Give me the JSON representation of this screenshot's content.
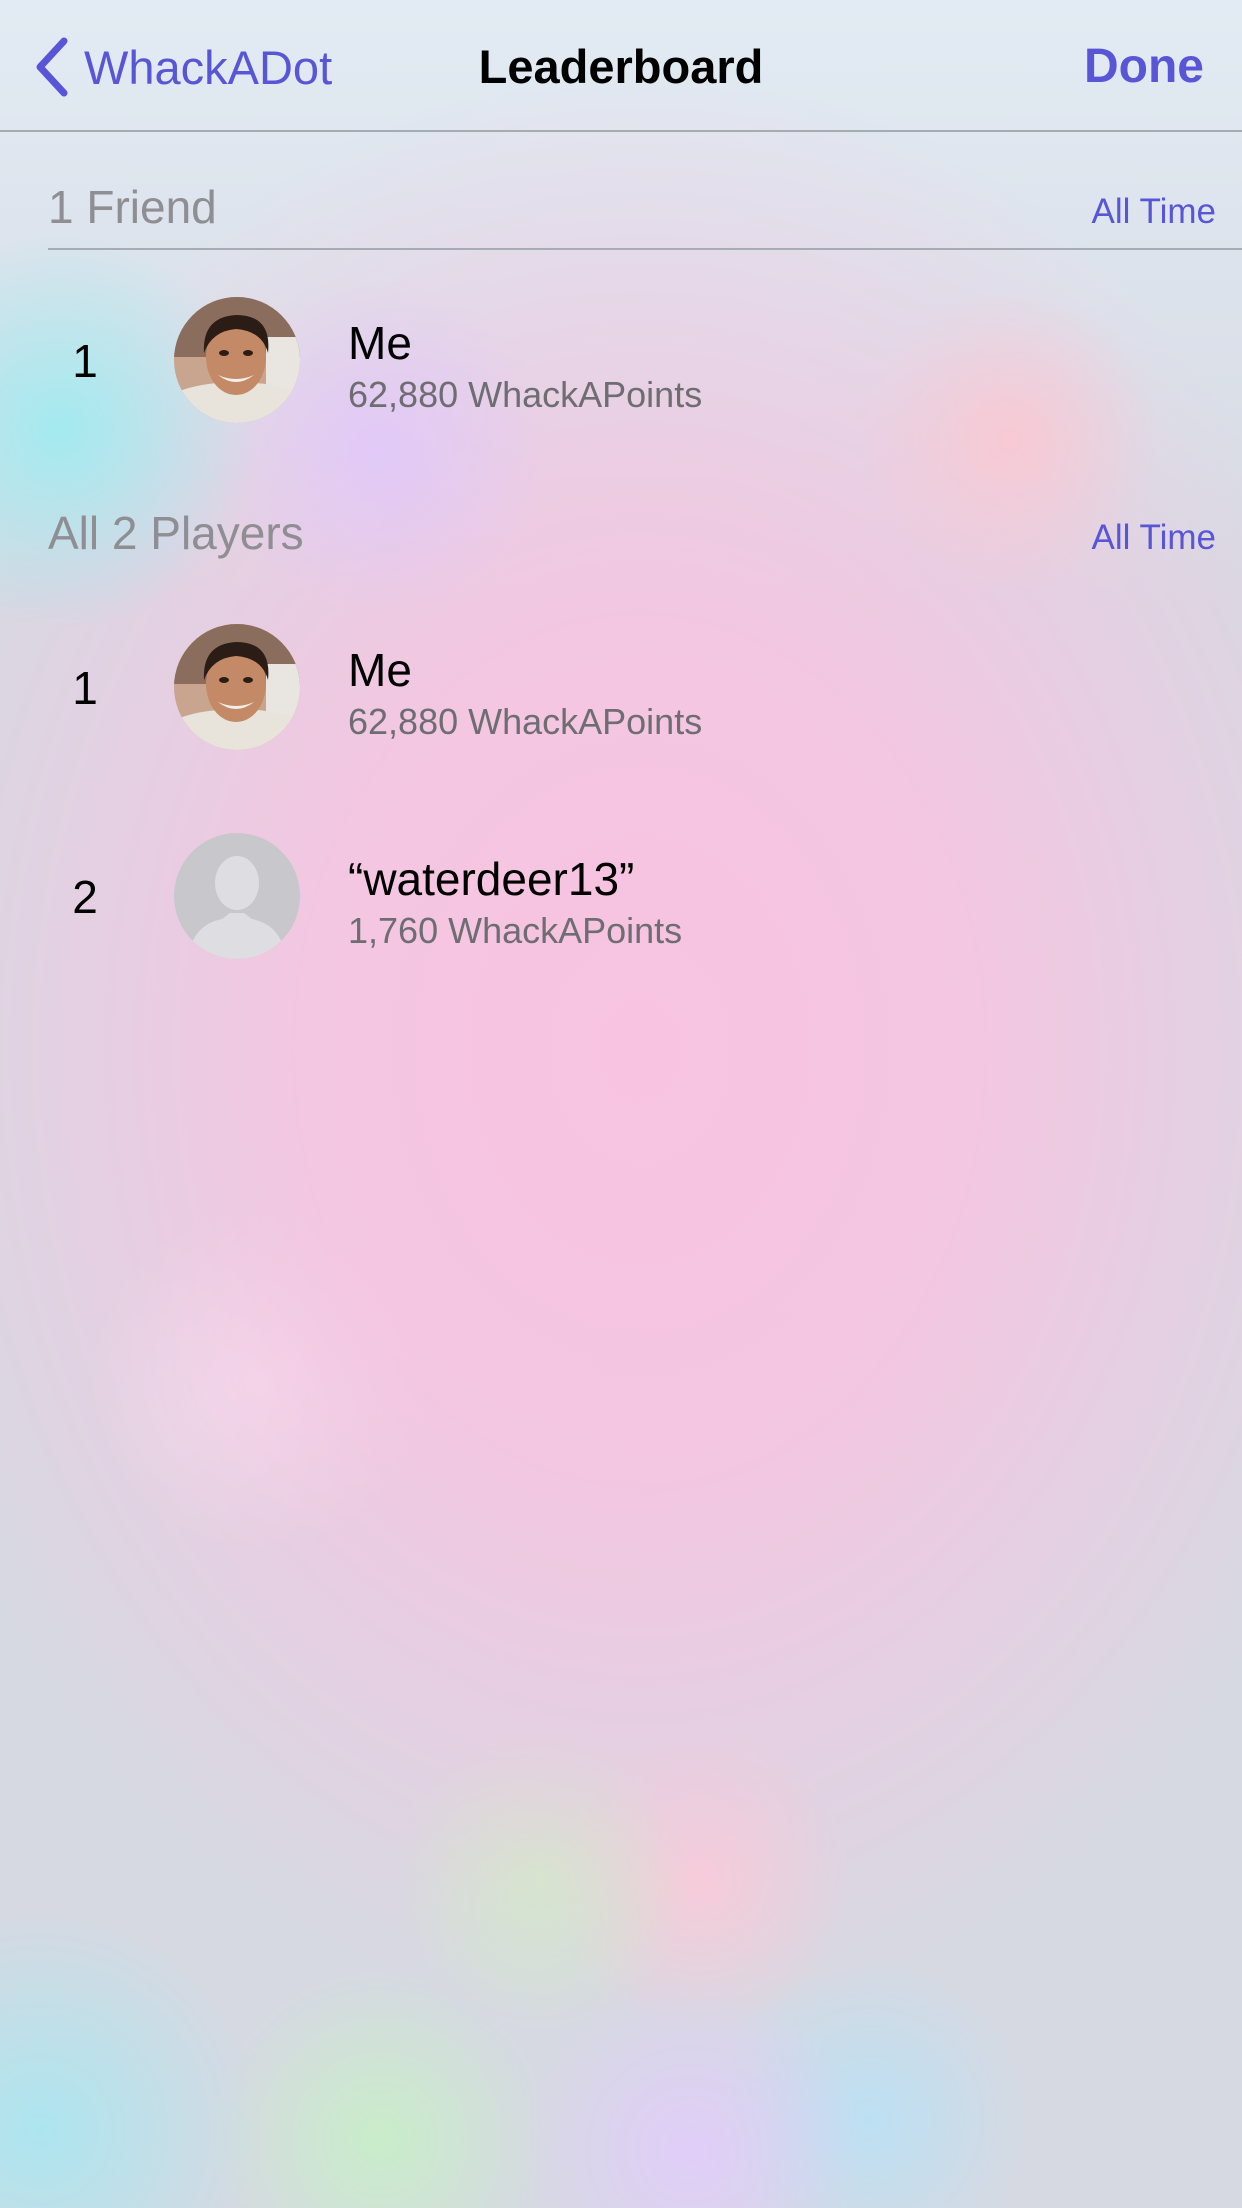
{
  "navbar": {
    "back_label": "WhackADot",
    "title": "Leaderboard",
    "done_label": "Done"
  },
  "sections": [
    {
      "title": "1 Friend",
      "scope": "All Time",
      "rows": [
        {
          "rank": "1",
          "name": "Me",
          "score": "62,880 WhackAPoints",
          "avatar": "photo"
        }
      ]
    },
    {
      "title": "All 2 Players",
      "scope": "All Time",
      "rows": [
        {
          "rank": "1",
          "name": "Me",
          "score": "62,880 WhackAPoints",
          "avatar": "photo"
        },
        {
          "rank": "2",
          "name": "“waterdeer13”",
          "score": "1,760 WhackAPoints",
          "avatar": "placeholder"
        }
      ]
    }
  ],
  "icons": {
    "back": "chevron-left-icon",
    "placeholder_avatar": "person-silhouette-icon"
  },
  "colors": {
    "accent": "#5856d6",
    "section_title": "#8e8e93",
    "subtitle": "#6d6d72"
  }
}
